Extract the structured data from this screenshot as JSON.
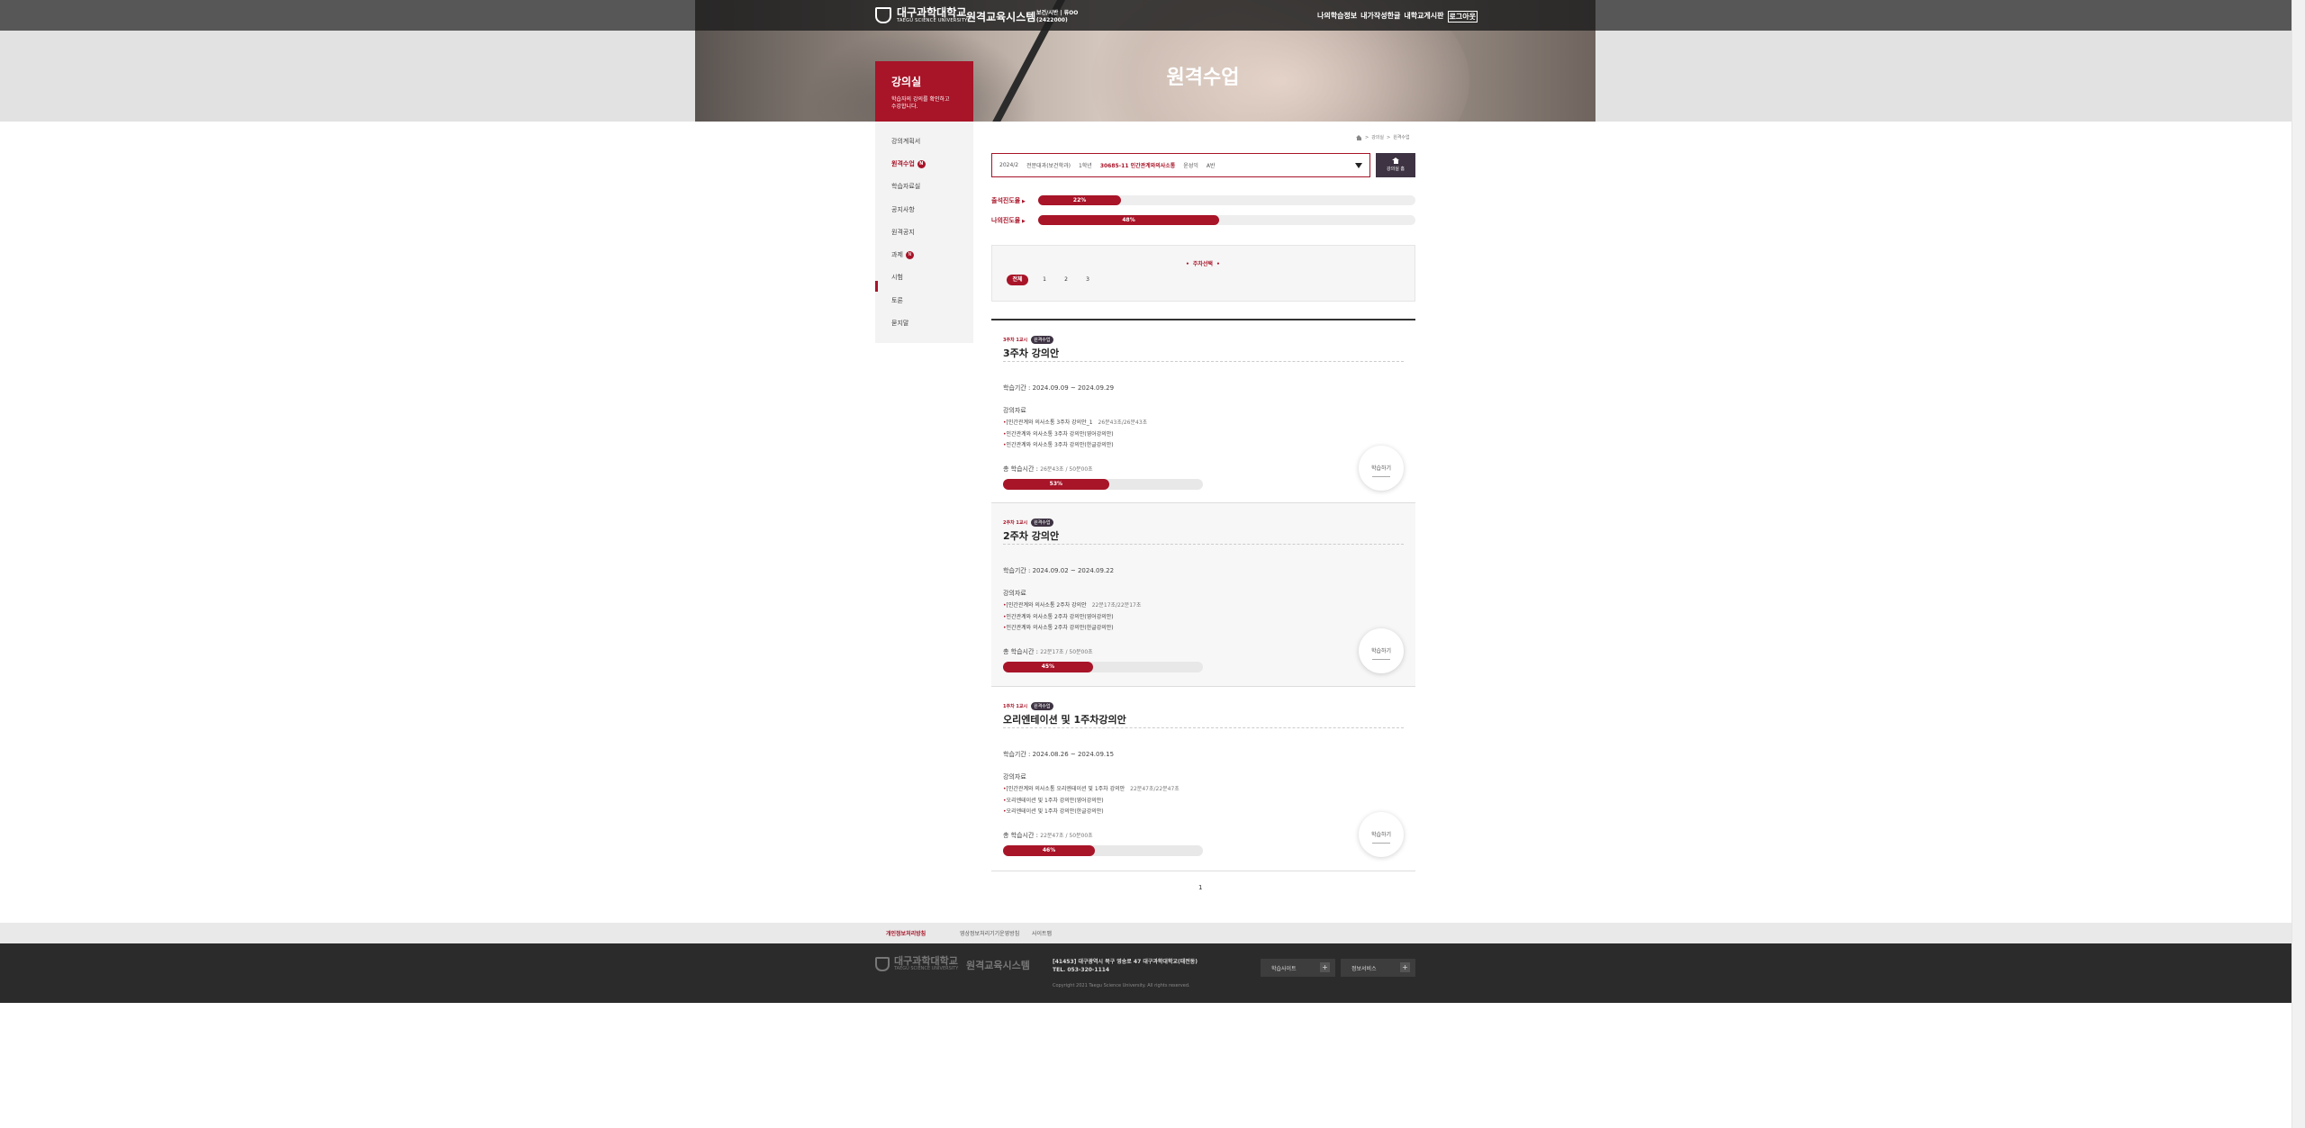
{
  "header": {
    "university": "대구과학대학교",
    "university_en": "TAEGU SCIENCE UNIVERSITY",
    "system_name": "원격교육시스템",
    "user_line1": "보건/시반 | 류OO",
    "user_line2": "(2422000)",
    "top_links": [
      "나의학습정보",
      "내가작성한글",
      "내학교게시판",
      "로그아웃"
    ],
    "page_title": "원격수업"
  },
  "sidebar": {
    "title": "강의실",
    "desc_line1": "학습자의 강의를 확인하고",
    "desc_line2": "수강합니다.",
    "items": [
      {
        "label": "강의계획서",
        "badge": ""
      },
      {
        "label": "원격수업",
        "badge": "N"
      },
      {
        "label": "학습자료실",
        "badge": ""
      },
      {
        "label": "공지사항",
        "badge": ""
      },
      {
        "label": "원격공지",
        "badge": ""
      },
      {
        "label": "과제",
        "badge": "N"
      },
      {
        "label": "시험",
        "badge": ""
      },
      {
        "label": "토론",
        "badge": ""
      },
      {
        "label": "묻지말",
        "badge": ""
      }
    ]
  },
  "breadcrumb": [
    "강의실",
    "원격수업"
  ],
  "course_selector": {
    "year": "2024/2",
    "dept": "전문대과(보건학과)",
    "grade": "1학년",
    "course": "30685-11 인간관계와의사소통",
    "professor": "윤성익",
    "class": "A반"
  },
  "classroom_button": "강의실 홈",
  "overall_progress": [
    {
      "label": "출석진도율",
      "value": 22,
      "text": "22%"
    },
    {
      "label": "나의진도율",
      "value": 48,
      "text": "48%"
    }
  ],
  "week_select": {
    "title": "주차선택",
    "options": [
      "전체",
      "1",
      "2",
      "3"
    ]
  },
  "lectures": [
    {
      "week": "3주차 1교시",
      "tag": "원격수업",
      "title": "3주차 강의안",
      "period": "학습기간 : 2024.09.09 ~ 2024.09.29",
      "materials_header": "강의자료",
      "materials": [
        {
          "text": "[인간관계와 의사소통 3주차 강의안_1",
          "time": "26분43초/26분43초"
        },
        {
          "text": "인간관계와 의사소통 3주차 강의안(영어강의안)",
          "time": ""
        },
        {
          "text": "인간관계와 의사소통 3주차 강의안(한글강의안)",
          "time": ""
        }
      ],
      "total_label": "총 학습시간 :",
      "total_value": "26분43초 / 50분00초",
      "progress": 53,
      "progress_text": "53%",
      "button": "학습하기"
    },
    {
      "week": "2주차 1교시",
      "tag": "원격수업",
      "title": "2주차 강의안",
      "period": "학습기간 : 2024.09.02 ~ 2024.09.22",
      "materials_header": "강의자료",
      "materials": [
        {
          "text": "[인간관계와 의사소통 2주차 강의안",
          "time": "22분17초/22분17초"
        },
        {
          "text": "인간관계와 의사소통 2주차 강의안(영어강의안)",
          "time": ""
        },
        {
          "text": "인간관계와 의사소통 2주차 강의안(한글강의안)",
          "time": ""
        }
      ],
      "total_label": "총 학습시간 :",
      "total_value": "22분17초 / 50분00초",
      "progress": 45,
      "progress_text": "45%",
      "button": "학습하기"
    },
    {
      "week": "1주차 1교시",
      "tag": "원격수업",
      "title": "오리엔테이션 및 1주차강의안",
      "period": "학습기간 : 2024.08.26 ~ 2024.09.15",
      "materials_header": "강의자료",
      "materials": [
        {
          "text": "[인간관계와 의사소통 오리엔테이션 및 1주차 강의안",
          "time": "22분47초/22분47초"
        },
        {
          "text": "오리엔테이션 및 1주차 강의안(영어강의안)",
          "time": ""
        },
        {
          "text": "오리엔테이션 및 1주차 강의안(한글강의안)",
          "time": ""
        }
      ],
      "total_label": "총 학습시간 :",
      "total_value": "22분47초 / 50분00초",
      "progress": 46,
      "progress_text": "46%",
      "button": "학습하기"
    }
  ],
  "pagination": "1",
  "footer": {
    "links": [
      "개인정보처리방침",
      "영상정보처리기기운영방침",
      "사이트맵"
    ],
    "university": "대구과학대학교",
    "university_en": "TAEGU SCIENCE UNIVERSITY",
    "system_name": "원격교육시스템",
    "address": "[41453] 대구광역시 북구 영송로 47 대구과학대학교(태전동)",
    "tel": "TEL. 053-320-1114",
    "copyright": "Copyright 2021 Taegu Science University. All rights reserved.",
    "select1": "학습사이트",
    "select2": "정보서비스"
  },
  "colors": {
    "brand": "#a81428",
    "dark": "#2b2b2b",
    "tag": "#3d3342"
  }
}
